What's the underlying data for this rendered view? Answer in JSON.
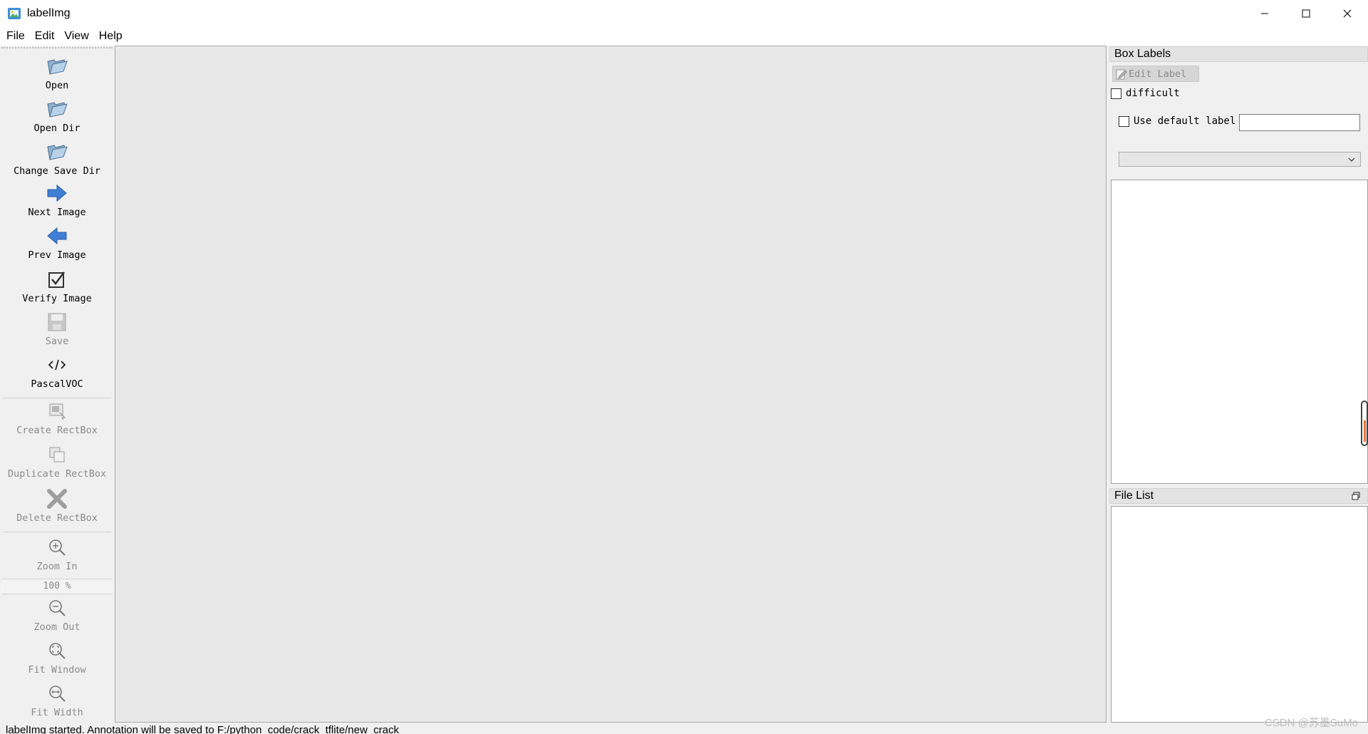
{
  "window": {
    "title": "labelImg",
    "controls": [
      "minimize-icon",
      "maximize-icon",
      "close-icon"
    ]
  },
  "menu": [
    "File",
    "Edit",
    "View",
    "Help"
  ],
  "toolbar": {
    "tools": [
      {
        "label": "Open",
        "icon": "folder-open-icon",
        "enabled": true
      },
      {
        "label": "Open Dir",
        "icon": "folder-open-icon",
        "enabled": true
      },
      {
        "label": "Change Save Dir",
        "icon": "folder-open-icon",
        "enabled": true
      },
      {
        "label": "Next Image",
        "icon": "arrow-right-icon",
        "enabled": true
      },
      {
        "label": "Prev Image",
        "icon": "arrow-left-icon",
        "enabled": true
      },
      {
        "label": "Verify Image",
        "icon": "checkbox-icon",
        "enabled": true
      },
      {
        "label": "Save",
        "icon": "save-icon",
        "enabled": false
      },
      {
        "label": "PascalVOC",
        "icon": "code-icon",
        "enabled": true
      },
      {
        "label": "Create RectBox",
        "icon": "create-rectbox-icon",
        "enabled": false
      },
      {
        "label": "Duplicate RectBox",
        "icon": "duplicate-icon",
        "enabled": false
      },
      {
        "label": "Delete RectBox",
        "icon": "delete-icon",
        "enabled": false
      },
      {
        "label": "Zoom In",
        "icon": "zoom-in-icon",
        "enabled": false
      },
      {
        "label": "Zoom Out",
        "icon": "zoom-out-icon",
        "enabled": false
      },
      {
        "label": "Fit Window",
        "icon": "fit-window-icon",
        "enabled": false
      },
      {
        "label": "Fit Width",
        "icon": "fit-width-icon",
        "enabled": false
      }
    ],
    "zoom_value": "100 %"
  },
  "box_labels": {
    "title": "Box Labels",
    "edit_label": "Edit Label",
    "difficult": "difficult",
    "use_default_label": "Use default label",
    "default_label_value": ""
  },
  "file_list": {
    "title": "File List"
  },
  "status": {
    "text": "labelImg started. Annotation will be saved to F:/python_code/crack_tflite/new_crack"
  },
  "watermark": "CSDN @苏墨SuMo",
  "colors": {
    "canvas": "#e8e8e8",
    "panel": "#f0f0f0",
    "accent_blue": "#3f7fd6",
    "scroll_accent": "#e8732a"
  }
}
